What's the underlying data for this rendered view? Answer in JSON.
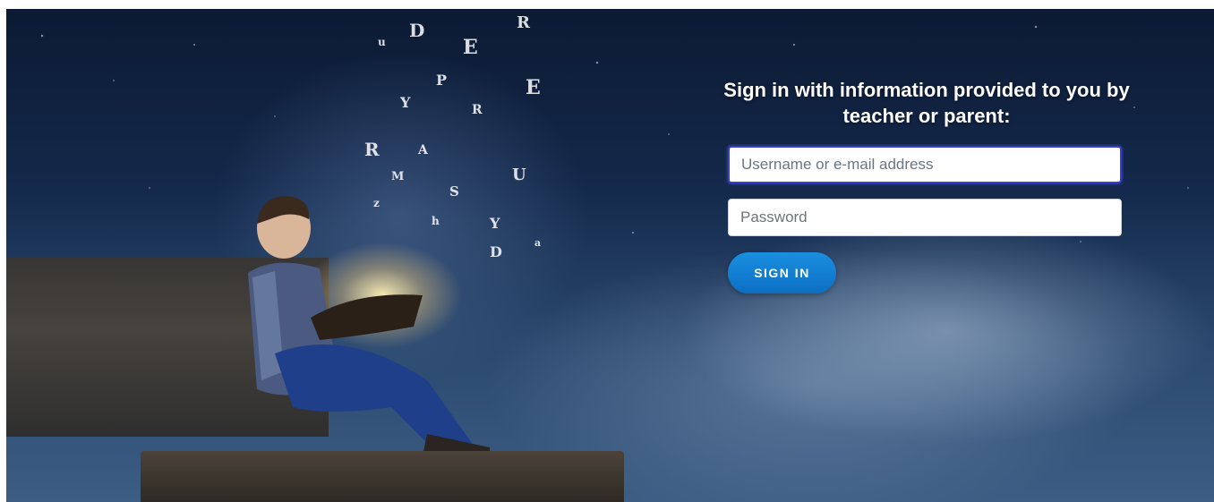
{
  "login": {
    "title": "Sign in with information provided to you by teacher or parent:",
    "username_placeholder": "Username or e-mail address",
    "username_value": "",
    "password_placeholder": "Password",
    "password_value": "",
    "signin_label": "SIGN IN"
  },
  "colors": {
    "button": "#0c6fc4",
    "focus_border": "#3b3bd0",
    "title_text": "#ffffff"
  },
  "icons": {
    "hero": "boy-reading-book-illustration"
  }
}
